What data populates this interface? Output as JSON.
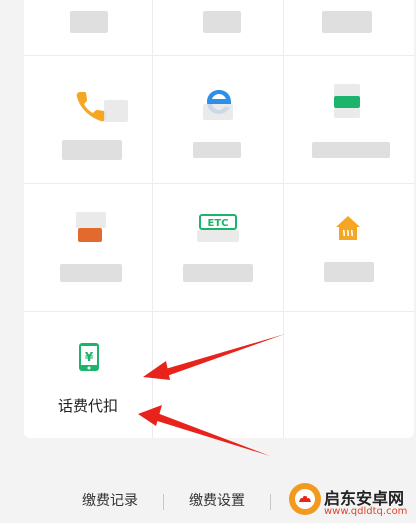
{
  "grid": {
    "deduct_label": "话费代扣"
  },
  "footer": {
    "records": "缴费记录",
    "settings": "缴费设置"
  },
  "watermark": {
    "title": "启东安卓网",
    "url": "www.qdldtq.com"
  },
  "colors": {
    "accent_orange": "#F5A623",
    "accent_blue": "#2E8FE6",
    "accent_green": "#1CB36C",
    "arrow_red": "#E8231B"
  },
  "icons": [
    "phone-icon",
    "browser-e-icon",
    "green-card-icon",
    "orange-block-icon",
    "etc-icon",
    "house-heat-icon",
    "phone-yen-icon"
  ]
}
